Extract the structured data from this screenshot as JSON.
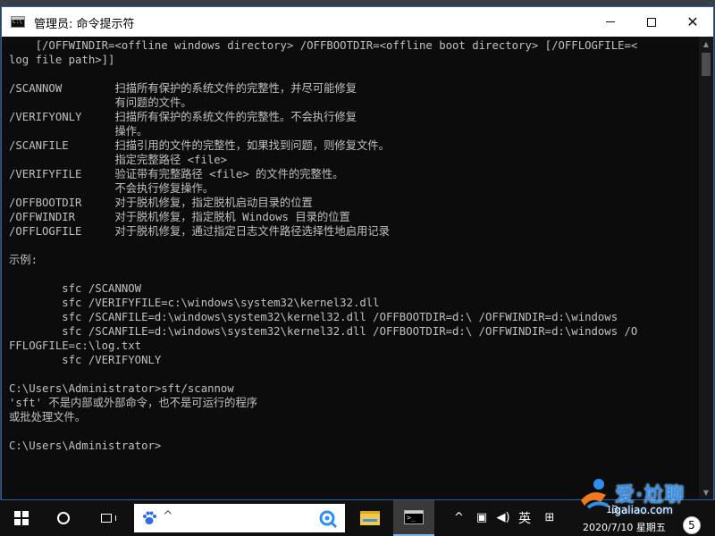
{
  "window": {
    "title": "管理员: 命令提示符",
    "minimize_label": "minimize",
    "maximize_label": "maximize",
    "close_glyph": "✕"
  },
  "console": {
    "lines": [
      "    [/OFFWINDIR=<offline windows directory> /OFFBOOTDIR=<offline boot directory> [/OFFLOGFILE=<",
      "log file path>]]",
      "",
      "/SCANNOW        扫描所有保护的系统文件的完整性，并尽可能修复",
      "                有问题的文件。",
      "/VERIFYONLY     扫描所有保护的系统文件的完整性。不会执行修复",
      "                操作。",
      "/SCANFILE       扫描引用的文件的完整性，如果找到问题，则修复文件。",
      "                指定完整路径 <file>",
      "/VERIFYFILE     验证带有完整路径 <file> 的文件的完整性。",
      "                不会执行修复操作。",
      "/OFFBOOTDIR     对于脱机修复，指定脱机启动目录的位置",
      "/OFFWINDIR      对于脱机修复，指定脱机 Windows 目录的位置",
      "/OFFLOGFILE     对于脱机修复，通过指定日志文件路径选择性地启用记录",
      "",
      "示例:",
      "",
      "        sfc /SCANNOW",
      "        sfc /VERIFYFILE=c:\\windows\\system32\\kernel32.dll",
      "        sfc /SCANFILE=d:\\windows\\system32\\kernel32.dll /OFFBOOTDIR=d:\\ /OFFWINDIR=d:\\windows",
      "        sfc /SCANFILE=d:\\windows\\system32\\kernel32.dll /OFFBOOTDIR=d:\\ /OFFWINDIR=d:\\windows /O",
      "FFLOGFILE=c:\\log.txt",
      "        sfc /VERIFYONLY",
      "",
      "C:\\Users\\Administrator>sft/scannow",
      "'sft' 不是内部或外部命令，也不是可运行的程序",
      "或批处理文件。",
      "",
      "C:\\Users\\Administrator>"
    ]
  },
  "taskbar": {
    "start_icon": "windows-logo-icon",
    "search_icon": "cortana-circle-icon",
    "taskview_icon": "task-view-icon",
    "searchbox_chevron": "^",
    "apps": [
      "file-explorer-icon",
      "command-prompt-icon"
    ],
    "tray_chevron": "^",
    "ime": "英",
    "clock_time": "13",
    "clock_date": "2020/7/10 星期五",
    "notification_count": "5"
  },
  "watermark": {
    "brand": "爱·尬聊",
    "url": "igaliao.com"
  },
  "colors": {
    "console_bg": "#0c0c0c",
    "console_fg": "#c0c0c0",
    "titlebar_bg": "#ffffff",
    "taskbar_bg": "#101010",
    "accent": "#2f8ff0"
  }
}
